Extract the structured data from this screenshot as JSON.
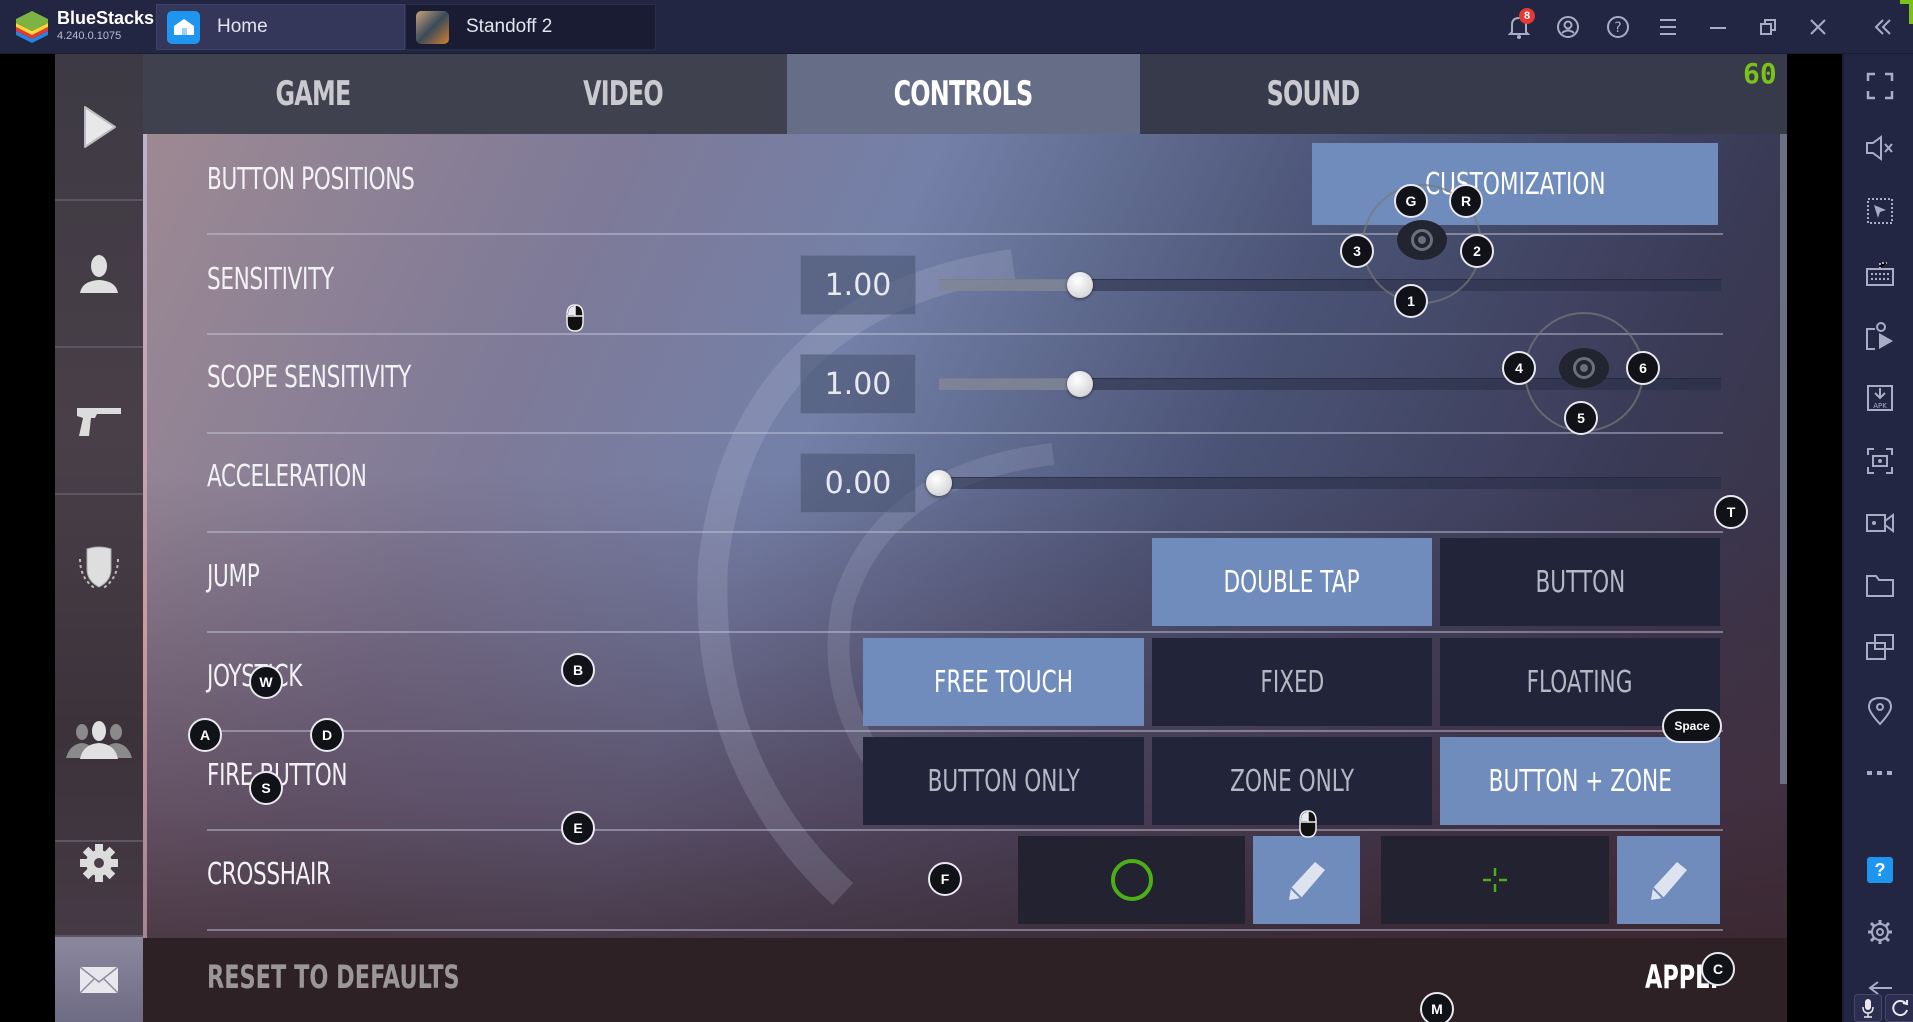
{
  "titlebar": {
    "app_name": "BlueStacks",
    "version": "4.240.0.1075",
    "tabs": [
      {
        "label": "Home",
        "icon": "home-icon"
      },
      {
        "label": "Standoff 2",
        "icon": "game-thumbnail"
      }
    ],
    "notification_count": "8",
    "controls": [
      "bell-icon",
      "account-icon",
      "help-icon",
      "menu-icon",
      "minimize-icon",
      "restore-icon",
      "close-icon",
      "collapse-sidebar-icon"
    ]
  },
  "game": {
    "fps": "60",
    "side_menu": [
      "play-icon",
      "profile-icon",
      "weapons-icon",
      "clan-shield-icon",
      "friends-icon",
      "settings-icon",
      "mail-icon"
    ],
    "tabs": [
      {
        "label": "GAME",
        "active": false
      },
      {
        "label": "VIDEO",
        "active": false
      },
      {
        "label": "CONTROLS",
        "active": true
      },
      {
        "label": "SOUND",
        "active": false
      }
    ],
    "rows": {
      "button_positions": {
        "label": "BUTTON POSITIONS",
        "button": "CUSTOMIZATION"
      },
      "sensitivity": {
        "label": "SENSITIVITY",
        "value": "1.00",
        "fraction": 0.18
      },
      "scope_sensitivity": {
        "label": "SCOPE SENSITIVITY",
        "value": "1.00",
        "fraction": 0.18
      },
      "acceleration": {
        "label": "ACCELERATION",
        "value": "0.00",
        "fraction": 0.0
      },
      "jump": {
        "label": "JUMP",
        "options": [
          "DOUBLE TAP",
          "BUTTON"
        ],
        "selected": "DOUBLE TAP"
      },
      "joystick": {
        "label": "JOYSTICK",
        "options": [
          "FREE TOUCH",
          "FIXED",
          "FLOATING"
        ],
        "selected": "FREE TOUCH"
      },
      "fire_button": {
        "label": "FIRE BUTTON",
        "options": [
          "BUTTON ONLY",
          "ZONE ONLY",
          "BUTTON + ZONE"
        ],
        "selected": "BUTTON + ZONE"
      },
      "crosshair": {
        "label": "CROSSHAIR",
        "primary_color": "#4caf1a",
        "secondary_color": "#4caf1a"
      }
    },
    "reset_label": "RESET TO DEFAULTS",
    "apply_label": "APPLY",
    "key_overlays": {
      "G": "G",
      "R": "R",
      "k1": "1",
      "k2": "2",
      "k3": "3",
      "k4": "4",
      "k5": "5",
      "k6": "6",
      "T": "T",
      "B": "B",
      "W": "W",
      "A": "A",
      "S": "S",
      "D": "D",
      "E": "E",
      "F": "F",
      "C": "C",
      "M": "M",
      "Space": "Space"
    }
  },
  "right_sidebar": {
    "icons": [
      "fullscreen-icon",
      "mute-icon",
      "pointer-select-icon",
      "keyboard-icon",
      "media-manager-icon",
      "install-apk-icon",
      "screenshot-icon",
      "record-icon",
      "folder-icon",
      "multi-instance-icon",
      "location-icon",
      "more-icon",
      "help-icon",
      "settings-icon",
      "back-icon"
    ],
    "help_label": "?"
  },
  "colors": {
    "accent_selected": "#6f8cbd",
    "fps_green": "#7bc11a",
    "badge_red": "#e53935"
  }
}
